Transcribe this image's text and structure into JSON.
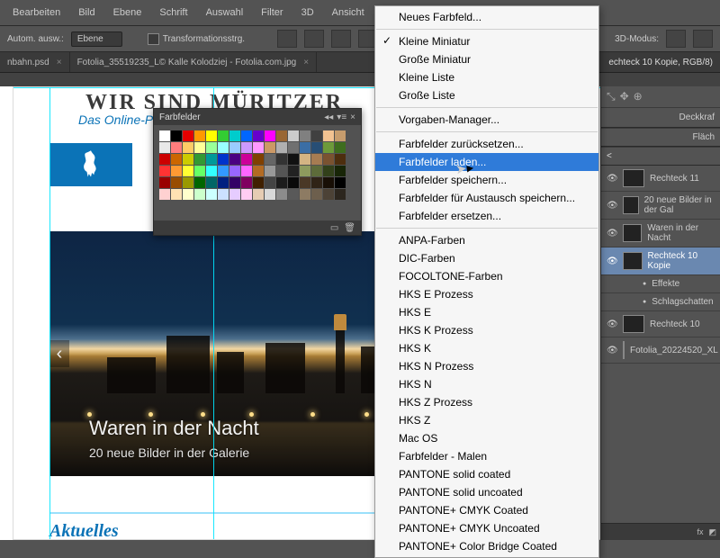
{
  "menubar": [
    "Bearbeiten",
    "Bild",
    "Ebene",
    "Schrift",
    "Auswahl",
    "Filter",
    "3D",
    "Ansicht"
  ],
  "optbar": {
    "auto": "Autom. ausw.:",
    "ebene": "Ebene",
    "transform": "Transformationsstrg.",
    "threeD": "3D-Modus:"
  },
  "tabs": [
    {
      "label": "nbahn.psd",
      "x": "×"
    },
    {
      "label": "Fotolia_35519235_L© Kalle Kolodziej - Fotolia.com.jpg",
      "x": "×"
    }
  ],
  "doc_title_right": "echteck 10 Kopie, RGB/8)",
  "page": {
    "headline": "WIR SIND MÜRITZER",
    "subtitle": "Das Online-Po",
    "hero_title": "Waren in der Nacht",
    "hero_sub": "20 neue Bilder in der Galerie",
    "section": "Aktuelles"
  },
  "swatch_panel": {
    "title": "Farbfelder"
  },
  "swatch_grid_colors": [
    "#ffffff",
    "#000000",
    "#e60000",
    "#ff9900",
    "#ffff00",
    "#33cc33",
    "#00cccc",
    "#0066ff",
    "#6600cc",
    "#ff00ff",
    "#996633",
    "#cccccc",
    "#808080",
    "#404040",
    "#f2c291",
    "#c69c6d",
    "#e8e8e8",
    "#ff7d7d",
    "#ffcc66",
    "#ffff99",
    "#99ff99",
    "#99ffff",
    "#99ccff",
    "#cc99ff",
    "#ff99ff",
    "#cc9966",
    "#b0b0b0",
    "#707070",
    "#3b6ea5",
    "#274e75",
    "#6d9a3a",
    "#3e6d1e",
    "#cc0000",
    "#cc6600",
    "#cccc00",
    "#339933",
    "#009999",
    "#0033cc",
    "#4b0082",
    "#cc0099",
    "#804000",
    "#666666",
    "#333333",
    "#111111",
    "#d4b483",
    "#a67c52",
    "#7a5230",
    "#4d2e0e",
    "#ff3333",
    "#ff9933",
    "#ffff33",
    "#66ff66",
    "#33ffff",
    "#3399ff",
    "#9966ff",
    "#ff66ff",
    "#b36b24",
    "#999999",
    "#555555",
    "#222222",
    "#8e9b5e",
    "#5d6b3a",
    "#32401a",
    "#182507",
    "#990000",
    "#994c00",
    "#999900",
    "#006600",
    "#006666",
    "#002080",
    "#330066",
    "#800060",
    "#402000",
    "#444444",
    "#1c1c1c",
    "#0a0a0a",
    "#4a3826",
    "#2f2317",
    "#180f06",
    "#000000",
    "#ffd1d1",
    "#ffe2b3",
    "#ffffcc",
    "#ccffcc",
    "#ccffff",
    "#cce0ff",
    "#e6ccff",
    "#ffccf2",
    "#e6ccb3",
    "#d9d9d9",
    "#8c8c8c",
    "#595959",
    "#8d7b63",
    "#6d5f4d",
    "#4c4236",
    "#2c261e"
  ],
  "context_menu": {
    "sections": [
      {
        "items": [
          {
            "t": "Neues Farbfeld..."
          }
        ]
      },
      {
        "items": [
          {
            "t": "Kleine Miniatur",
            "c": true
          },
          {
            "t": "Große Miniatur"
          },
          {
            "t": "Kleine Liste"
          },
          {
            "t": "Große Liste"
          }
        ]
      },
      {
        "items": [
          {
            "t": "Vorgaben-Manager..."
          }
        ]
      },
      {
        "items": [
          {
            "t": "Farbfelder zurücksetzen..."
          },
          {
            "t": "Farbfelder laden...",
            "hl": true
          },
          {
            "t": "Farbfelder speichern..."
          },
          {
            "t": "Farbfelder für Austausch speichern..."
          },
          {
            "t": "Farbfelder ersetzen..."
          }
        ]
      },
      {
        "items": [
          {
            "t": "ANPA-Farben"
          },
          {
            "t": "DIC-Farben"
          },
          {
            "t": "FOCOLTONE-Farben"
          },
          {
            "t": "HKS E Prozess"
          },
          {
            "t": "HKS E"
          },
          {
            "t": "HKS K Prozess"
          },
          {
            "t": "HKS K"
          },
          {
            "t": "HKS N Prozess"
          },
          {
            "t": "HKS N"
          },
          {
            "t": "HKS Z Prozess"
          },
          {
            "t": "HKS Z"
          },
          {
            "t": "Mac OS"
          },
          {
            "t": "Farbfelder - Malen"
          },
          {
            "t": "PANTONE solid coated"
          },
          {
            "t": "PANTONE solid uncoated"
          },
          {
            "t": "PANTONE+ CMYK Coated"
          },
          {
            "t": "PANTONE+ CMYK Uncoated"
          },
          {
            "t": "PANTONE+ Color Bridge Coated"
          }
        ]
      }
    ]
  },
  "right_panel": {
    "deckkraft": "Deckkraf",
    "flaeche": "Fläch",
    "path_back": "<",
    "layers": [
      {
        "name": "Rechteck 11"
      },
      {
        "name": "20 neue Bilder in der Gal"
      },
      {
        "name": "Waren in der Nacht"
      },
      {
        "name": "Rechteck 10 Kopie",
        "sel": true
      },
      {
        "name": "Effekte",
        "fx": true
      },
      {
        "name": "Schlagschatten",
        "fx": true
      },
      {
        "name": "Rechteck 10"
      },
      {
        "name": "Fotolia_20224520_XL"
      }
    ]
  }
}
